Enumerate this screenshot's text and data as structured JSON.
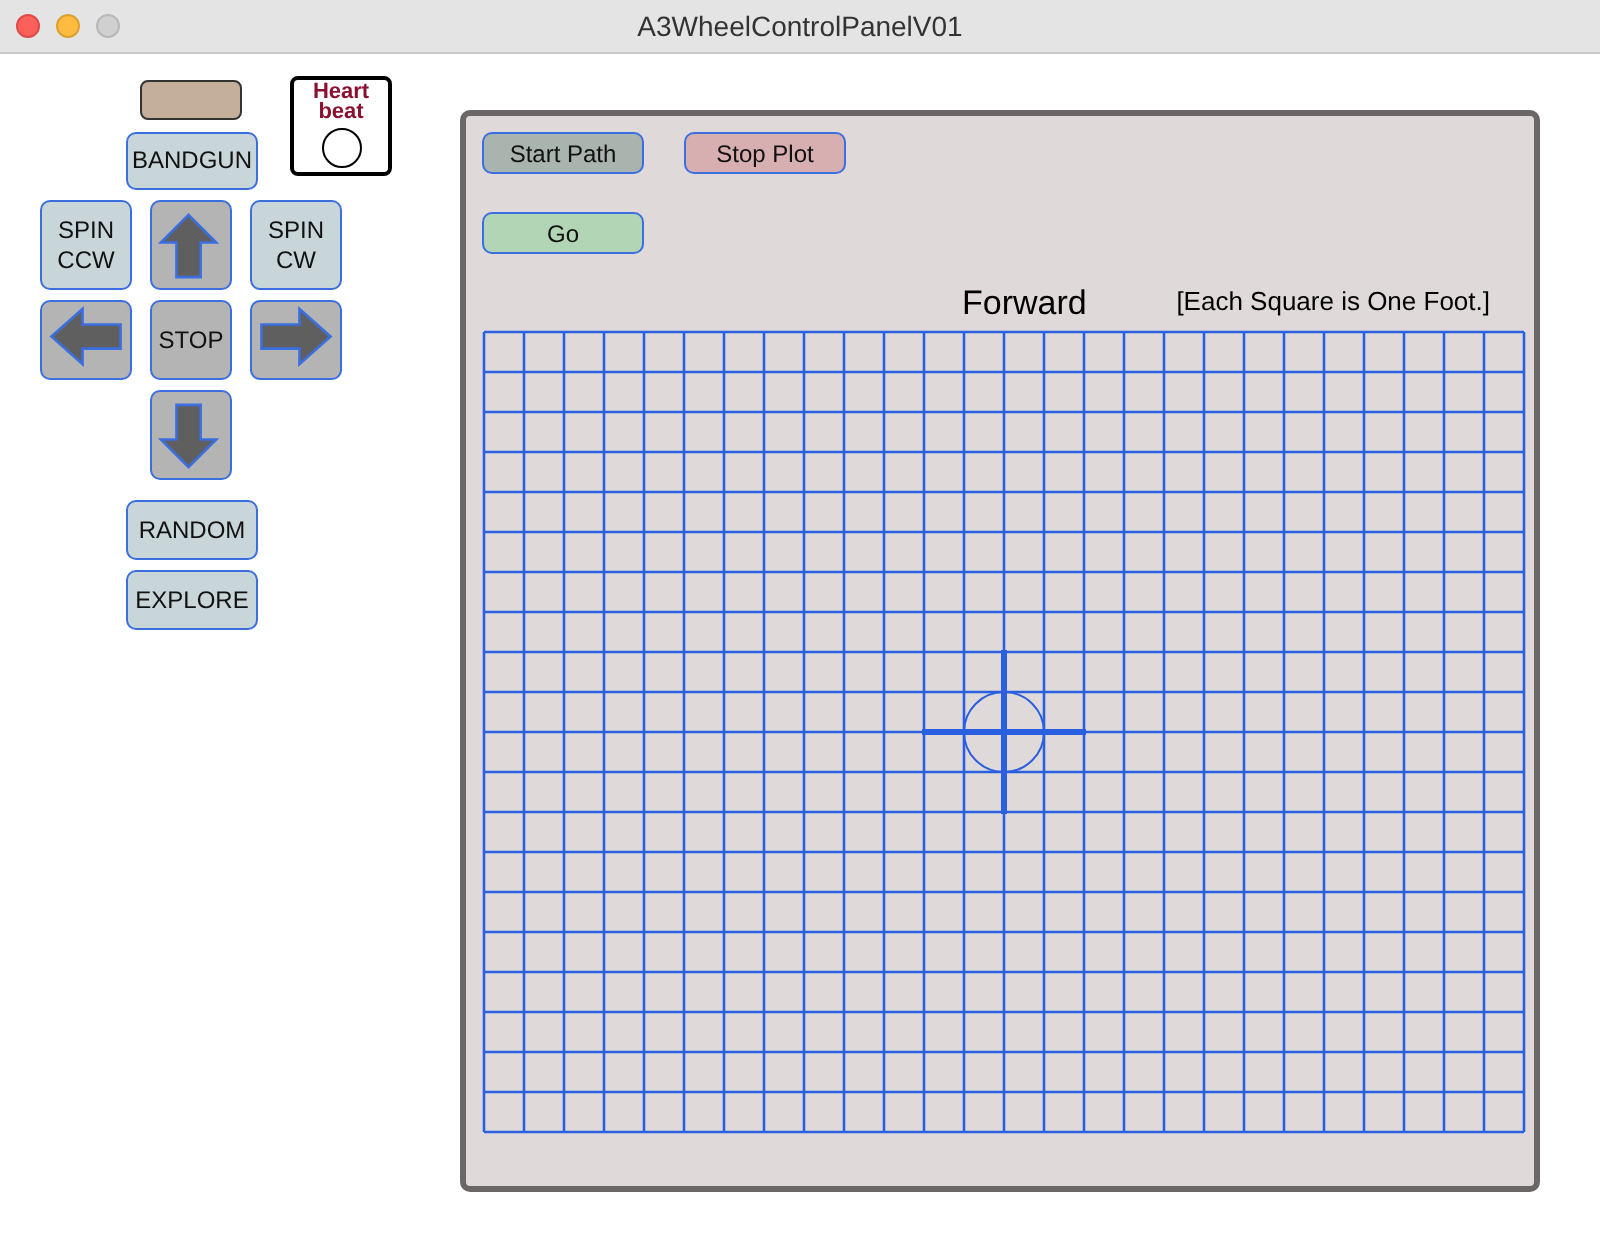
{
  "window": {
    "title": "A3WheelControlPanelV01"
  },
  "heartbeat": {
    "label": "Heart beat"
  },
  "controls": [
    {
      "kind": "blank"
    },
    {
      "kind": "text",
      "label": "BANDGUN"
    },
    {
      "kind": "text",
      "label": "SPIN CCW"
    },
    {
      "kind": "up"
    },
    {
      "kind": "text",
      "label": "SPIN CW"
    },
    {
      "kind": "left"
    },
    {
      "kind": "stop",
      "label": "STOP"
    },
    {
      "kind": "right"
    },
    {
      "kind": "down"
    },
    {
      "kind": "text",
      "label": "RANDOM"
    },
    {
      "kind": "text",
      "label": "EXPLORE"
    }
  ],
  "plot": {
    "buttons": [
      {
        "label": "Start Path",
        "color": "#a9b4ae"
      },
      {
        "label": "Stop Plot",
        "color": "#d7afb1"
      },
      {
        "label": "Go",
        "color": "#b2d6b5"
      }
    ],
    "heading": "Forward",
    "note": "[Each Square is One Foot.]"
  }
}
